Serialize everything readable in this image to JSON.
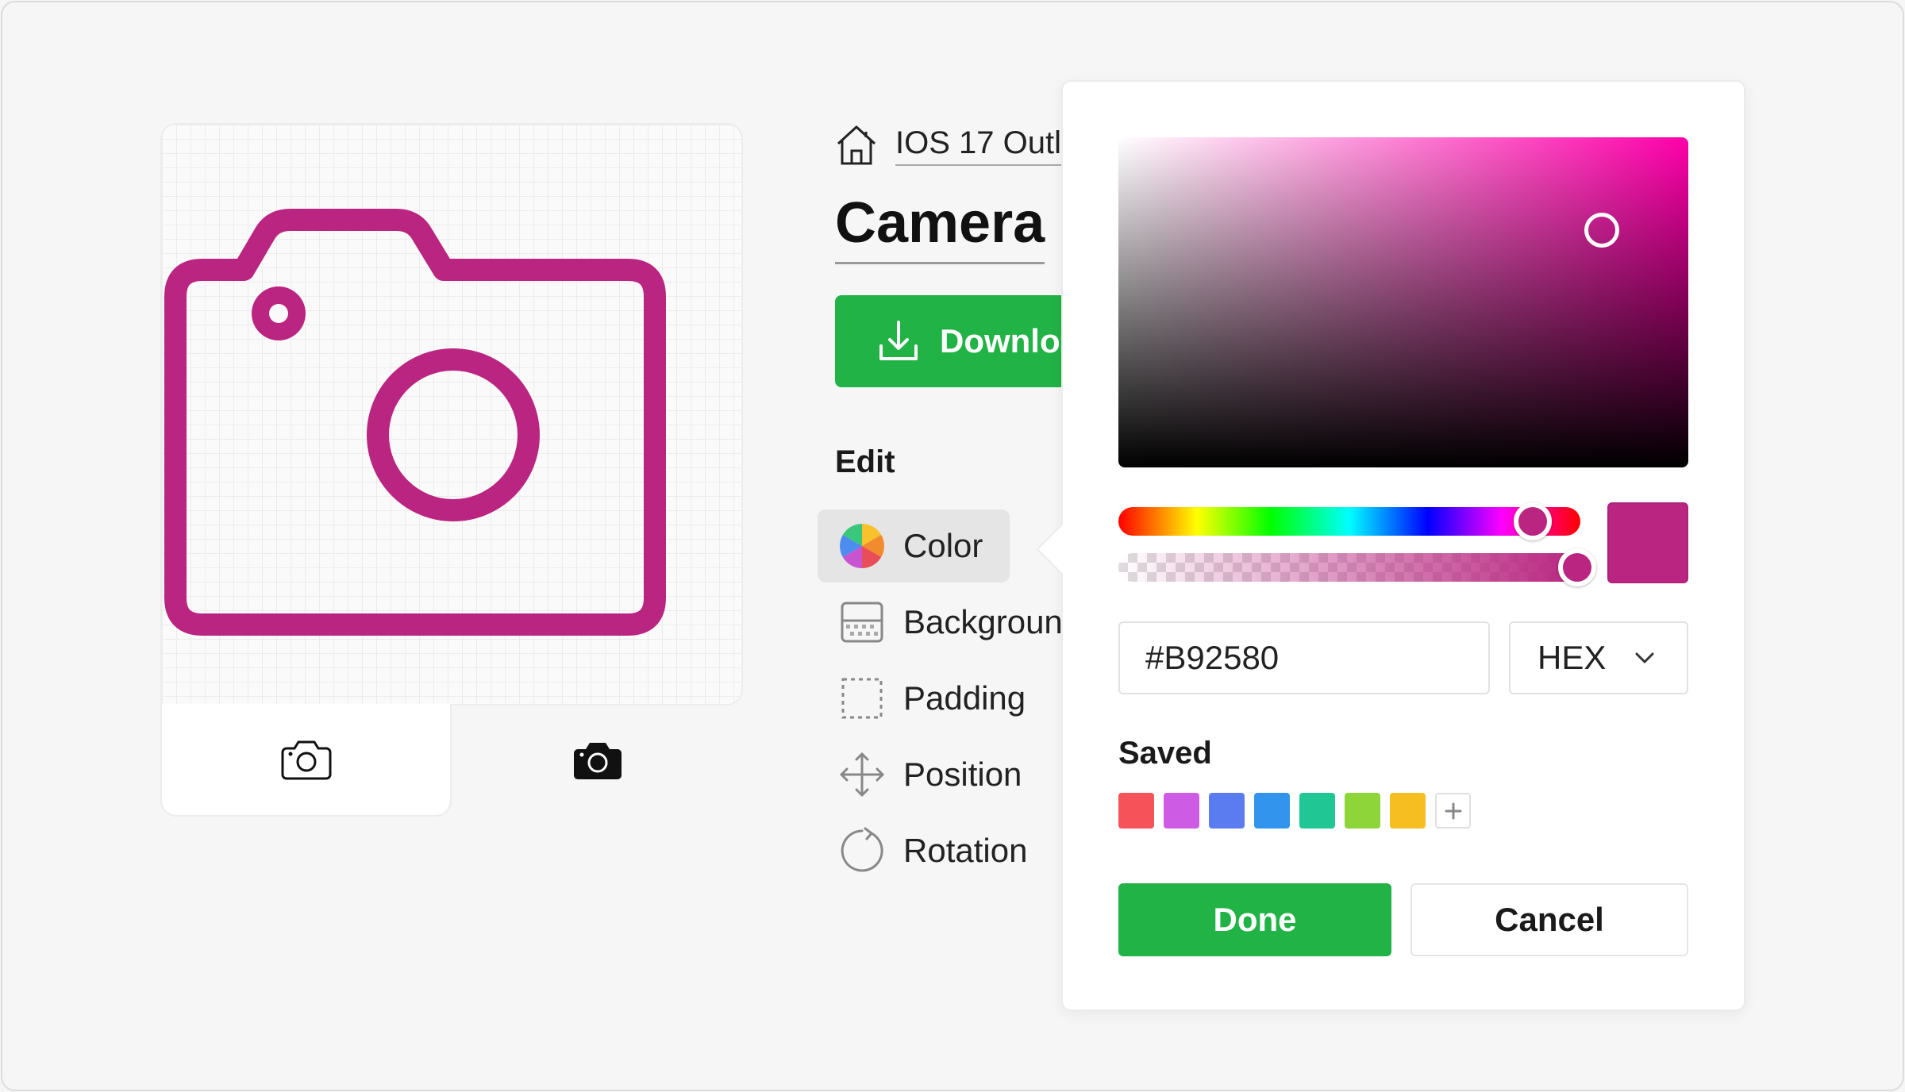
{
  "preview": {
    "icon_name": "camera-outline-icon",
    "icon_color": "#B92580",
    "variants": [
      {
        "name": "outline",
        "icon": "camera-outline-icon",
        "active": true
      },
      {
        "name": "filled",
        "icon": "camera-filled-icon",
        "active": false
      }
    ]
  },
  "breadcrumb": {
    "icon": "home-icon",
    "label": "IOS 17 Outl"
  },
  "title": "Camera",
  "download": {
    "label": "Downloa",
    "icon": "download-icon",
    "color": "#21B345"
  },
  "edit": {
    "heading": "Edit",
    "items": [
      {
        "label": "Color",
        "icon": "color-wheel-icon",
        "active": true
      },
      {
        "label": "Backgroun",
        "icon": "background-icon",
        "active": false
      },
      {
        "label": "Padding",
        "icon": "padding-icon",
        "active": false
      },
      {
        "label": "Position",
        "icon": "move-arrows-icon",
        "active": false
      },
      {
        "label": "Rotation",
        "icon": "rotate-icon",
        "active": false
      }
    ]
  },
  "color_picker": {
    "hue_color": "#FF00AA",
    "selected_color": "#B92580",
    "hex_value": "#B92580",
    "format": "HEX",
    "saved_heading": "Saved",
    "saved_colors": [
      "#F5525A",
      "#CE5BE3",
      "#5B7CF1",
      "#3394ED",
      "#20C794",
      "#8ED53A",
      "#F7BE22"
    ],
    "add_label": "+",
    "done_label": "Done",
    "cancel_label": "Cancel"
  }
}
